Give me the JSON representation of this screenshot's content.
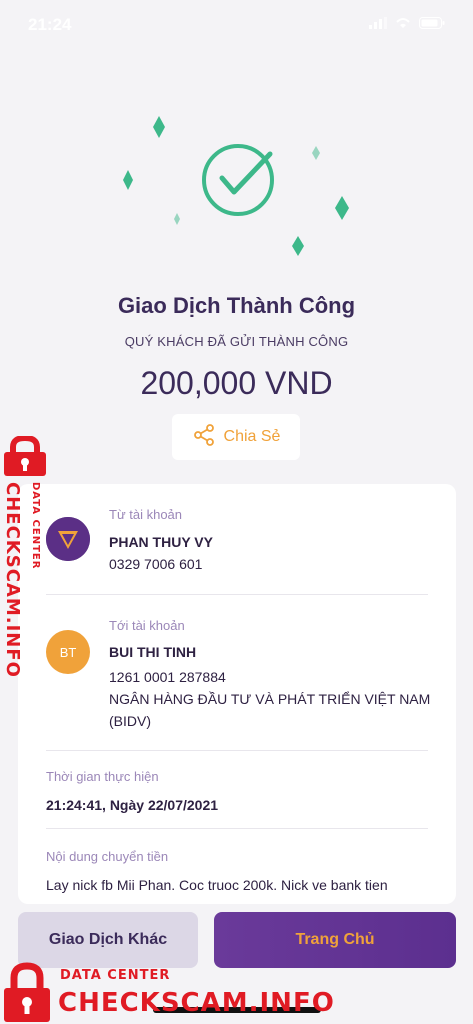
{
  "status_bar": {
    "time": "21:24"
  },
  "hero": {
    "title": "Giao Dịch Thành Công",
    "subtitle": "QUÝ KHÁCH ĐÃ GỬI THÀNH CÔNG",
    "amount": "200,000 VND",
    "share_label": "Chia Sẻ",
    "accent_color": "#3db88a"
  },
  "from": {
    "label": "Từ tài khoản",
    "name": "PHAN THUY VY",
    "account": "0329 7006 601"
  },
  "to": {
    "label": "Tới tài khoản",
    "avatar_initials": "BT",
    "name": "BUI THI TINH",
    "account": "1261 0001 287884",
    "bank_line1": "NGÂN HÀNG ĐẦU TƯ VÀ PHÁT TRIỂN VIỆT NAM",
    "bank_line2": "(BIDV)"
  },
  "time": {
    "label": "Thời gian thực hiện",
    "value": "21:24:41, Ngày 22/07/2021"
  },
  "content": {
    "label": "Nội dung chuyển tiền",
    "value": "Lay nick fb Mii Phan. Coc truoc 200k. Nick ve bank tien"
  },
  "buttons": {
    "other": "Giao Dịch Khác",
    "home": "Trang Chủ"
  },
  "watermark": {
    "line1": "DATA CENTER",
    "line2": "CHECKSCAM.INFO"
  }
}
